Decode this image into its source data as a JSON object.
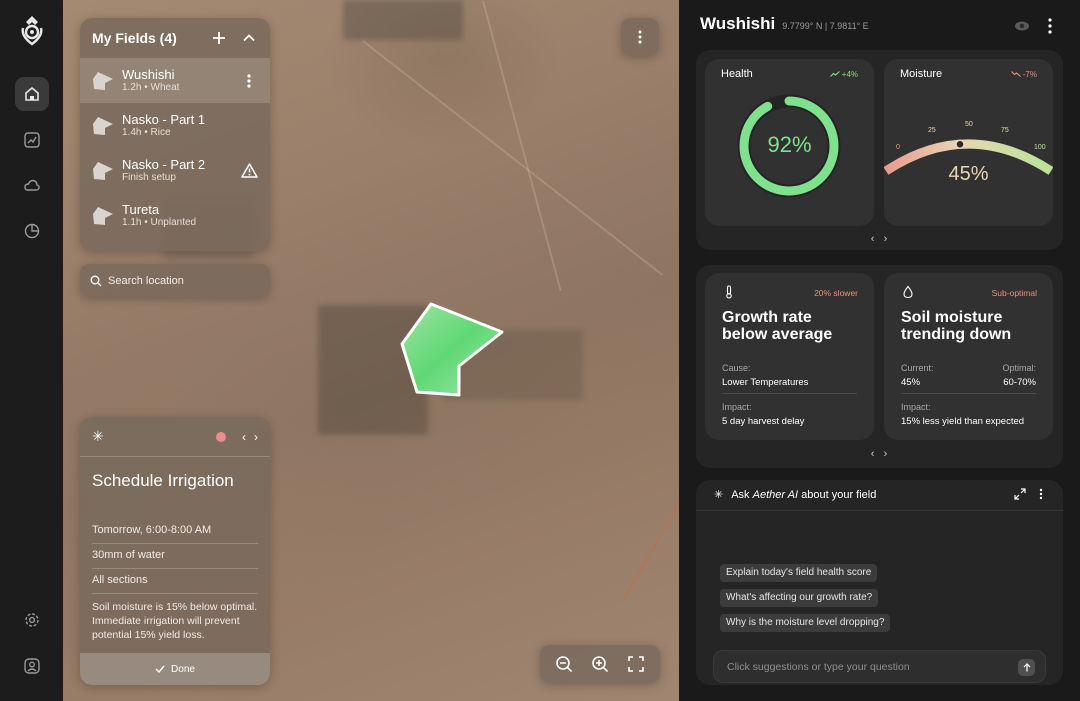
{
  "fields_panel": {
    "title": "My Fields (4)",
    "items": [
      {
        "name": "Wushishi",
        "sub": "1.2h • Wheat"
      },
      {
        "name": "Nasko - Part 1",
        "sub": "1.4h • Rice"
      },
      {
        "name": "Nasko - Part 2",
        "sub": "Finish setup"
      },
      {
        "name": "Tureta",
        "sub": "1.1h • Unplanted"
      }
    ]
  },
  "search": {
    "placeholder": "Search location"
  },
  "irrigation": {
    "title": "Schedule Irrigation",
    "rows": [
      "Tomorrow, 6:00-8:00 AM",
      "30mm of water",
      "All sections"
    ],
    "note": "Soil moisture is 15% below optimal. Immediate irrigation will prevent potential 15% yield loss.",
    "done": "Done"
  },
  "header": {
    "field_name": "Wushishi",
    "coords": "9.7799° N | 7.9811° E"
  },
  "health": {
    "label": "Health",
    "delta": "+4%",
    "value_text": "92%",
    "value": 92
  },
  "moisture": {
    "label": "Moisture",
    "delta": "-7%",
    "value_text": "45%",
    "value": 45,
    "ticks": [
      "0",
      "25",
      "50",
      "75",
      "100"
    ]
  },
  "growth": {
    "tag": "20% slower",
    "title_line1": "Growth rate",
    "title_line2": "below average",
    "cause_label": "Cause:",
    "cause": "Lower Temperatures",
    "impact_label": "Impact:",
    "impact": "5 day harvest delay"
  },
  "soil": {
    "tag": "Sub-optimal",
    "title_line1": "Soil moisture",
    "title_line2": "trending down",
    "current_label": "Current:",
    "current": "45%",
    "optimal_label": "Optimal:",
    "optimal": "60-70%",
    "impact_label": "Impact:",
    "impact": "15% less yield than expected"
  },
  "ai": {
    "prefix": "Ask",
    "brand": "Aether AI",
    "suffix": "about your field",
    "suggestions": [
      "Explain today's field health score",
      "What's affecting our growth rate?",
      "Why is the moisture level dropping?"
    ],
    "input_placeholder": "Click suggestions or type your question"
  },
  "colors": {
    "accent_green": "#7fe08d",
    "warning_red": "#e7927e",
    "panel": "#252525",
    "card": "#313131"
  }
}
